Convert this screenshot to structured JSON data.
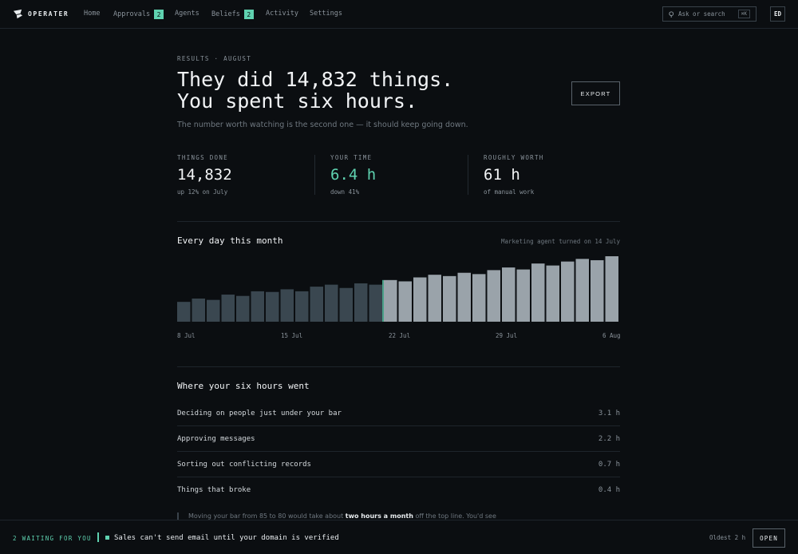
{
  "app": {
    "name": "OPERATER"
  },
  "nav": {
    "items": [
      {
        "label": "Home",
        "badge": ""
      },
      {
        "label": "Approvals",
        "badge": "2"
      },
      {
        "label": "Agents",
        "badge": ""
      },
      {
        "label": "Beliefs",
        "badge": "2"
      },
      {
        "label": "Activity",
        "badge": ""
      },
      {
        "label": "Settings",
        "badge": ""
      }
    ],
    "search_placeholder": "Ask or search",
    "search_shortcut": "⌘K",
    "avatar_initials": "ED"
  },
  "main": {
    "eyebrow": "RESULTS · AUGUST",
    "headline_line1": "They did 14,832 things.",
    "headline_line2": "You spent six hours.",
    "subtitle": "The number worth watching is the second one — it should keep going down.",
    "export_label": "EXPORT",
    "stats": [
      {
        "label": "THINGS DONE",
        "value": "14,832",
        "note": "up 12% on July",
        "accent": false
      },
      {
        "label": "YOUR TIME",
        "value": "6.4 h",
        "note": "down 41%",
        "accent": true
      },
      {
        "label": "ROUGHLY WORTH",
        "value": "61 h",
        "note": "of manual work",
        "accent": false
      }
    ]
  },
  "chart_data": {
    "type": "bar",
    "title": "Every day this month",
    "annotation": "Marketing agent turned on 14 July",
    "x_tick_labels": [
      "8 Jul",
      "15 Jul",
      "22 Jul",
      "29 Jul",
      "6 Aug"
    ],
    "categories": [
      "8 Jul",
      "9 Jul",
      "10 Jul",
      "11 Jul",
      "12 Jul",
      "13 Jul",
      "14 Jul",
      "15 Jul",
      "16 Jul",
      "17 Jul",
      "18 Jul",
      "19 Jul",
      "20 Jul",
      "21 Jul",
      "22 Jul",
      "23 Jul",
      "24 Jul",
      "25 Jul",
      "26 Jul",
      "27 Jul",
      "28 Jul",
      "29 Jul",
      "30 Jul",
      "31 Jul",
      "1 Aug",
      "2 Aug",
      "3 Aug",
      "4 Aug",
      "5 Aug",
      "6 Aug"
    ],
    "values": [
      0.3,
      0.35,
      0.33,
      0.41,
      0.39,
      0.46,
      0.45,
      0.49,
      0.46,
      0.53,
      0.56,
      0.51,
      0.58,
      0.56,
      0.63,
      0.61,
      0.67,
      0.71,
      0.69,
      0.74,
      0.72,
      0.78,
      0.82,
      0.79,
      0.88,
      0.85,
      0.91,
      0.95,
      0.93,
      0.99
    ],
    "highlight_from_index": 14,
    "grid": false,
    "colors": {
      "before": "#3a4750",
      "after": "#9aa3aa",
      "marker": "#5fd2b0"
    }
  },
  "breakdown": {
    "title": "Where your six hours went",
    "rows": [
      {
        "label": "Deciding on people just under your bar",
        "hours": "3.1 h"
      },
      {
        "label": "Approving messages",
        "hours": "2.2 h"
      },
      {
        "label": "Sorting out conflicting records",
        "hours": "0.7 h"
      },
      {
        "label": "Things that broke",
        "hours": "0.4 h"
      }
    ],
    "note_prefix": "Moving your bar from 85 to 80 would take about ",
    "note_emphasis": "two hours a month",
    "note_suffix": " off the top line. You'd see"
  },
  "bottombar": {
    "waiting": "2 WAITING FOR YOU",
    "message": "Sales can't send email until your domain is verified",
    "oldest": "Oldest 2 h",
    "open_label": "OPEN"
  },
  "colors": {
    "accent": "#5fd2b0",
    "background": "#0b0e11"
  }
}
